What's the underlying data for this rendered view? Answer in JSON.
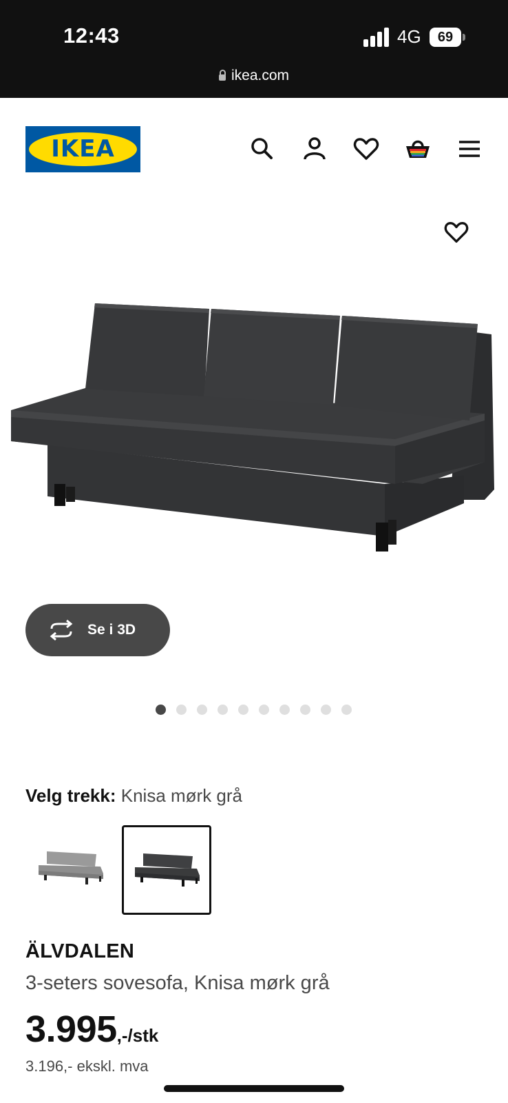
{
  "status_bar": {
    "time": "12:43",
    "network": "4G",
    "battery": "69"
  },
  "browser": {
    "url": "ikea.com"
  },
  "header": {
    "logo_text": "IKEA",
    "icons": [
      "search-icon",
      "account-icon",
      "favourites-icon",
      "cart-icon",
      "menu-icon"
    ],
    "brand_colors": {
      "blue": "#0058a3",
      "yellow": "#ffdb00"
    }
  },
  "gallery": {
    "view_3d_label": "Se i 3D",
    "image_count": 10,
    "active_index": 0
  },
  "variant": {
    "label": "Velg trekk:",
    "selected_value": "Knisa mørk grå",
    "options": [
      {
        "color": "#8e8e8e",
        "selected": false
      },
      {
        "color": "#3a3b3c",
        "selected": true
      }
    ]
  },
  "product": {
    "name": "ÄLVDALEN",
    "description": "3-seters sovesofa, Knisa mørk grå",
    "price_main": "3.995",
    "price_suffix": ",-/stk",
    "price_ex_vat": "3.196,- ekskl. mva"
  }
}
